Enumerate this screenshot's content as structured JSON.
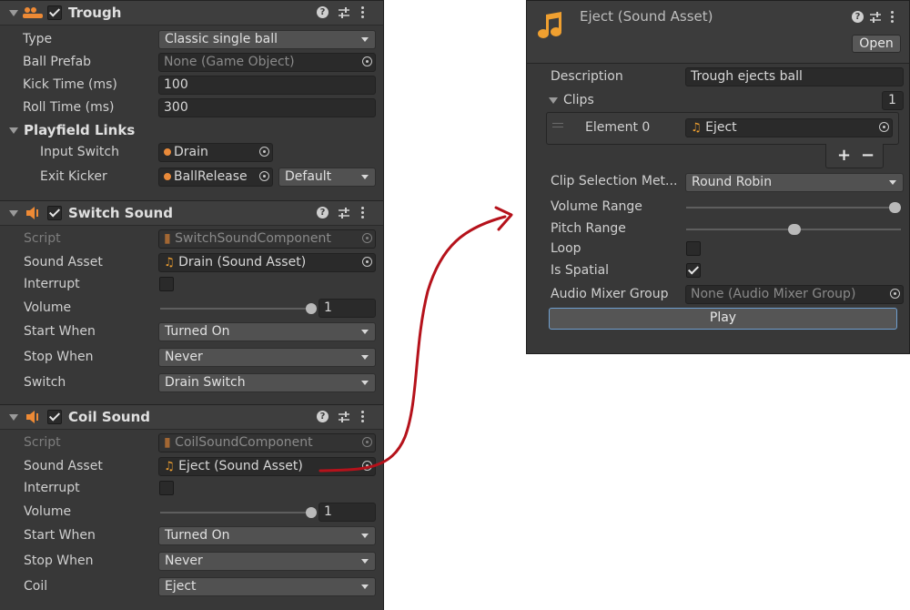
{
  "trough": {
    "title": "Trough",
    "type_label": "Type",
    "type_value": "Classic single ball",
    "ball_prefab_label": "Ball Prefab",
    "ball_prefab_value": "None (Game Object)",
    "kick_time_label": "Kick Time (ms)",
    "kick_time_value": "100",
    "roll_time_label": "Roll Time (ms)",
    "roll_time_value": "300",
    "playfield_links_label": "Playfield Links",
    "input_switch_label": "Input Switch",
    "input_switch_value": "Drain",
    "exit_kicker_label": "Exit Kicker",
    "exit_kicker_value": "BallRelease",
    "exit_kicker_mode": "Default"
  },
  "switch_sound": {
    "title": "Switch Sound",
    "script_label": "Script",
    "script_value": "SwitchSoundComponent",
    "sound_asset_label": "Sound Asset",
    "sound_asset_value": "Drain (Sound Asset)",
    "interrupt_label": "Interrupt",
    "volume_label": "Volume",
    "volume_value": "1",
    "start_when_label": "Start When",
    "start_when_value": "Turned On",
    "stop_when_label": "Stop When",
    "stop_when_value": "Never",
    "switch_label": "Switch",
    "switch_value": "Drain Switch"
  },
  "coil_sound": {
    "title": "Coil Sound",
    "script_label": "Script",
    "script_value": "CoilSoundComponent",
    "sound_asset_label": "Sound Asset",
    "sound_asset_value": "Eject (Sound Asset)",
    "interrupt_label": "Interrupt",
    "volume_label": "Volume",
    "volume_value": "1",
    "start_when_label": "Start When",
    "start_when_value": "Turned On",
    "stop_when_label": "Stop When",
    "stop_when_value": "Never",
    "coil_label": "Coil",
    "coil_value": "Eject"
  },
  "asset": {
    "title": "Eject (Sound Asset)",
    "open_label": "Open",
    "description_label": "Description",
    "description_value": "Trough ejects ball",
    "clips_label": "Clips",
    "clips_count": "1",
    "element_label": "Element 0",
    "element_value": "Eject",
    "plus_label": "+",
    "minus_label": "−",
    "clip_selection_label": "Clip Selection Met...",
    "clip_selection_value": "Round Robin",
    "volume_range_label": "Volume Range",
    "pitch_range_label": "Pitch Range",
    "loop_label": "Loop",
    "is_spatial_label": "Is Spatial",
    "mixer_label": "Audio Mixer Group",
    "mixer_value": "None (Audio Mixer Group)",
    "play_label": "Play"
  },
  "icons": [
    "trough-icon",
    "speaker-icon",
    "help-icon",
    "settings-sliders-icon",
    "more-vertical-icon",
    "music-note-icon",
    "object-picker-icon",
    "checkbox-icon",
    "foldout-arrow-icon",
    "dropdown-arrow-icon"
  ],
  "colors": {
    "panel": "#383838",
    "header": "#3e3e3e",
    "accent": "#ee8a35",
    "arrow": "#b5121b",
    "note": "#f0a030"
  }
}
